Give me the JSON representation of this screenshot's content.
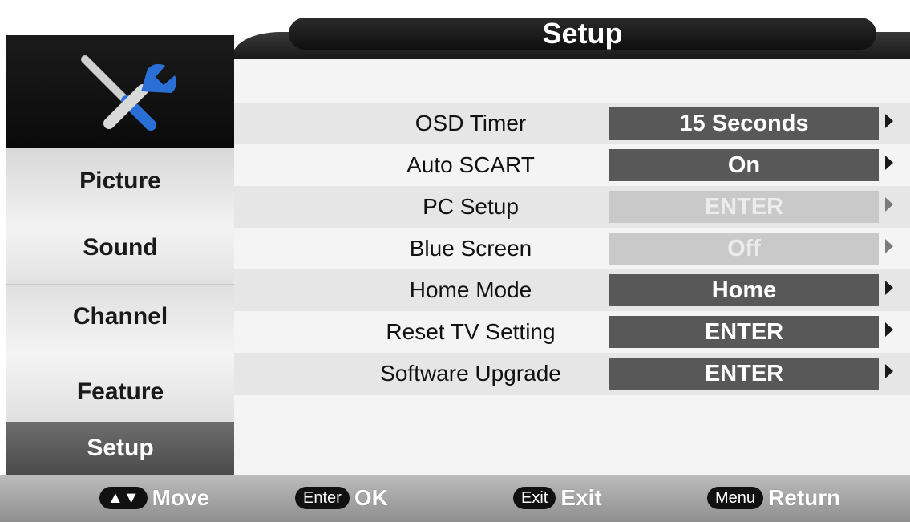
{
  "header": {
    "title": "Setup"
  },
  "sidebar": {
    "icon": "tools-icon",
    "items": [
      {
        "label": "Picture"
      },
      {
        "label": "Sound"
      },
      {
        "label": "Channel"
      },
      {
        "label": "Feature"
      },
      {
        "label": "Setup",
        "active": true
      }
    ]
  },
  "settings": [
    {
      "label": "OSD Timer",
      "value": "15 Seconds",
      "enabled": true
    },
    {
      "label": "Auto SCART",
      "value": "On",
      "enabled": true
    },
    {
      "label": "PC Setup",
      "value": "ENTER",
      "enabled": false
    },
    {
      "label": "Blue Screen",
      "value": "Off",
      "enabled": false
    },
    {
      "label": "Home Mode",
      "value": "Home",
      "enabled": true
    },
    {
      "label": "Reset TV Setting",
      "value": "ENTER",
      "enabled": true
    },
    {
      "label": "Software Upgrade",
      "value": "ENTER",
      "enabled": true
    }
  ],
  "footer": {
    "hints": [
      {
        "key": "▲▼",
        "action": "Move"
      },
      {
        "key": "Enter",
        "action": "OK"
      },
      {
        "key": "Exit",
        "action": "Exit"
      },
      {
        "key": "Menu",
        "action": "Return"
      }
    ]
  },
  "colors": {
    "active_value_bg": "#585858",
    "disabled_value_bg": "#c9c9c9",
    "sidebar_active_bg": "#5a5a5a"
  }
}
